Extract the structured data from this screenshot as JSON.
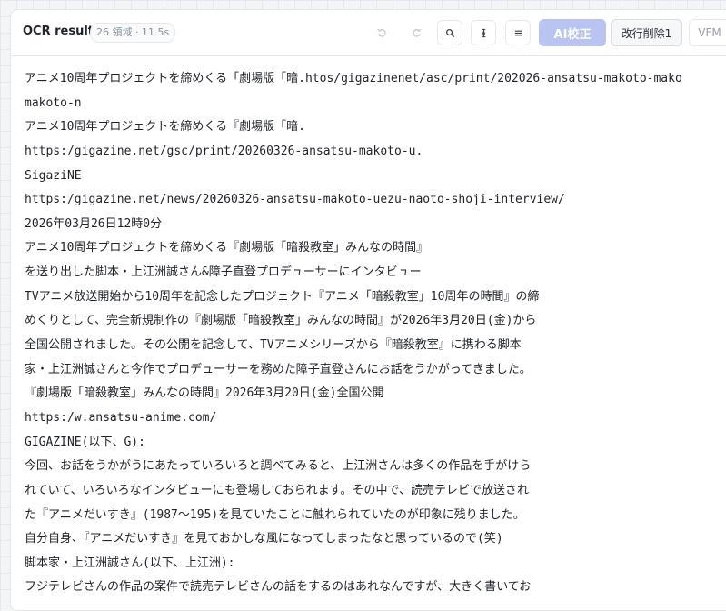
{
  "header": {
    "title": "OCR result",
    "meta": "26 領域 · 11.5s"
  },
  "toolbar": {
    "icons": [
      "undo-icon",
      "redo-icon",
      "search-icon",
      "text-cursor-icon",
      "wrap-lines-icon"
    ],
    "ai_label": "AI校正",
    "remove_breaks_label": "改行削除1",
    "vfm_label": "VFM"
  },
  "lines": [
    "アニメ10周年プロジェクトを締めくる「劇場版「暗.htos/gigazinenet/asc/print/202026-ansatsu-makoto-mako",
    "makoto-n",
    "アニメ10周年プロジェクトを締めくる『劇場版「暗.",
    "https:/gigazine.net/gsc/print/20260326-ansatsu-makoto-u.",
    "SigaziNE",
    "https:/gigazine.net/news/20260326-ansatsu-makoto-uezu-naoto-shoji-interview/",
    "2026年03月26日12時0分",
    "アニメ10周年プロジェクトを締めくる『劇場版「暗殺教室」みんなの時間』",
    "を送り出した脚本・上江洲誠さん&障子直登プロデューサーにインタビュー",
    "TVアニメ放送開始から10周年を記念したプロジェクト『アニメ「暗殺教室」10周年の時間』の締",
    "めくりとして、完全新規制作の『劇場版「暗殺教室」みんなの時間』が2026年3月20日(金)から",
    "全国公開されました。その公開を記念して、TVアニメシリーズから『暗殺教室』に携わる脚本",
    "家・上江洲誠さんと今作でプロデューサーを務めた障子直登さんにお話をうかがってきました。",
    "『劇場版「暗殺教室」みんなの時間』2026年3月20日(金)全国公開",
    "https:/w.ansatsu-anime.com/",
    "GIGAZINE(以下、G):",
    "今回、お話をうかがうにあたっていろいろと調べてみると、上江洲さんは多くの作品を手がけら",
    "れていて、いろいろなインタビューにも登場しておられます。その中で、読売テレビで放送され",
    "た『アニメだいすき』(1987〜195)を見ていたことに触れられていたのが印象に残りました。",
    "自分自身、『アニメだいすき』を見ておかしな風になってしまったなと思っているので(笑)",
    "脚本家・上江洲誠さん(以下、上江洲):",
    "フジテレビさんの作品の案件で読売テレビさんの話をするのはあれなんですが、大きく書いてお"
  ]
}
